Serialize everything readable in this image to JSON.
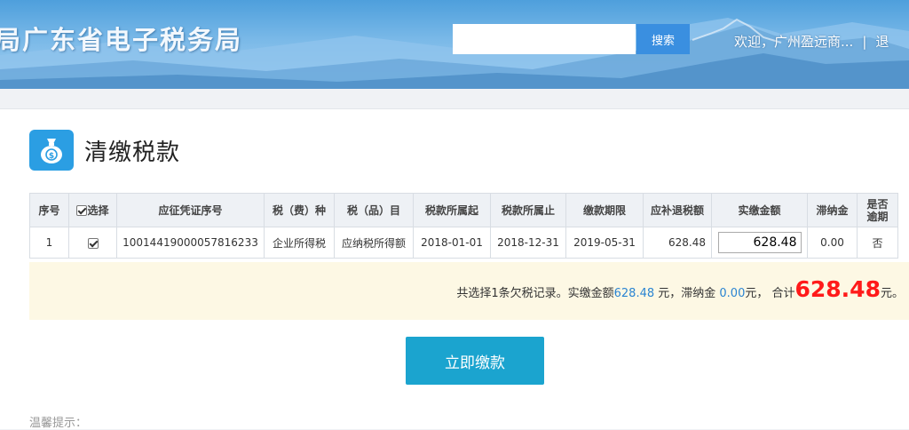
{
  "header": {
    "site_title": "局广东省电子税务局",
    "search": {
      "placeholder": "",
      "value": "",
      "button_label": "搜索"
    },
    "welcome_text": "欢迎，广州盈远商...",
    "separator": "|",
    "logout_label": "退"
  },
  "page": {
    "title": "清缴税款",
    "icon": "money-bag-icon"
  },
  "table": {
    "headers": {
      "seq": "序号",
      "select": "选择",
      "voucher_no": "应征凭证序号",
      "tax_type": "税（费）种",
      "tax_item": "税（品）目",
      "period_start": "税款所属起",
      "period_end": "税款所属止",
      "due_date": "缴款期限",
      "tax_due": "应补退税额",
      "actual_amount": "实缴金额",
      "late_fee": "滞纳金",
      "overdue_line1": "是否",
      "overdue_line2": "逾期"
    },
    "rows": [
      {
        "seq": "1",
        "selected": true,
        "voucher_no": "10014419000057816233",
        "tax_type": "企业所得税",
        "tax_item": "应纳税所得额",
        "period_start": "2018-01-01",
        "period_end": "2018-12-31",
        "due_date": "2019-05-31",
        "tax_due": "628.48",
        "actual_amount": "628.48",
        "late_fee": "0.00",
        "overdue": "否"
      }
    ]
  },
  "summary": {
    "prefix": "共选择1条欠税记录。实缴金额",
    "actual_amount": "628.48",
    "mid1": " 元，滞纳金 ",
    "late_fee": "0.00",
    "mid2": "元， 合计",
    "total": "628.48",
    "suffix": "元。"
  },
  "pay_button_label": "立即缴款",
  "tip_label": "温馨提示：",
  "colors": {
    "accent": "#1ba4cf",
    "total_red": "#ff1a1a",
    "amount_blue": "#2a84d2",
    "summary_bg": "#fdf8e4"
  }
}
